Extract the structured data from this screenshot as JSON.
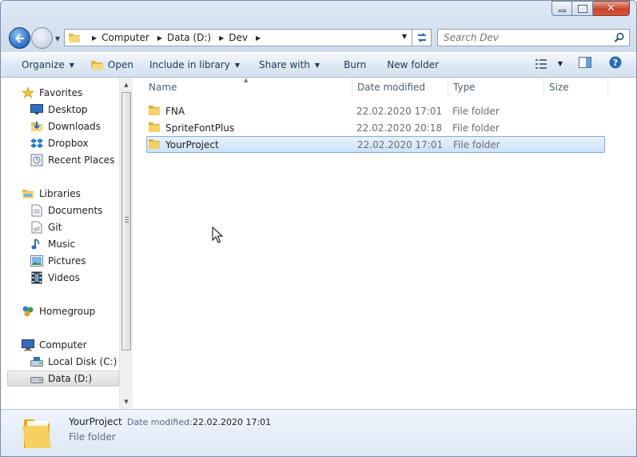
{
  "address": {
    "crumbs": [
      "Computer",
      "Data (D:)",
      "Dev"
    ]
  },
  "search": {
    "placeholder": "Search Dev"
  },
  "toolbar": {
    "organize": "Organize",
    "open": "Open",
    "include_in_library": "Include in library",
    "share_with": "Share with",
    "burn": "Burn",
    "new_folder": "New folder"
  },
  "nav": {
    "favorites": "Favorites",
    "desktop": "Desktop",
    "downloads": "Downloads",
    "dropbox": "Dropbox",
    "recent_places": "Recent Places",
    "libraries": "Libraries",
    "documents": "Documents",
    "git": "Git",
    "music": "Music",
    "pictures": "Pictures",
    "videos": "Videos",
    "homegroup": "Homegroup",
    "computer": "Computer",
    "local_disk": "Local Disk (C:)",
    "data_disk": "Data (D:)"
  },
  "columns": {
    "name": "Name",
    "date_modified": "Date modified",
    "type": "Type",
    "size": "Size"
  },
  "files": [
    {
      "name": "FNA",
      "date": "22.02.2020 17:01",
      "type": "File folder"
    },
    {
      "name": "SpriteFontPlus",
      "date": "22.02.2020 20:18",
      "type": "File folder"
    },
    {
      "name": "YourProject",
      "date": "22.02.2020 17:01",
      "type": "File folder"
    }
  ],
  "details": {
    "name": "YourProject",
    "date_label": "Date modified:",
    "date_value": "22.02.2020 17:01",
    "type": "File folder"
  },
  "colors": {
    "selection_border": "#84acdd",
    "selection_fill": "#cde3fa",
    "toolbar_text": "#1e395b",
    "folder_yellow": "#f1c84a"
  },
  "icons": [
    "back-arrow-icon",
    "forward-arrow-icon",
    "folder-icon",
    "refresh-icon",
    "search-icon",
    "star-icon",
    "desktop-icon",
    "downloads-icon",
    "dropbox-icon",
    "recent-places-icon",
    "libraries-icon",
    "documents-icon",
    "git-icon",
    "music-icon",
    "pictures-icon",
    "videos-icon",
    "homegroup-icon",
    "computer-icon",
    "disk-icon",
    "view-options-icon",
    "preview-pane-icon",
    "help-icon"
  ]
}
